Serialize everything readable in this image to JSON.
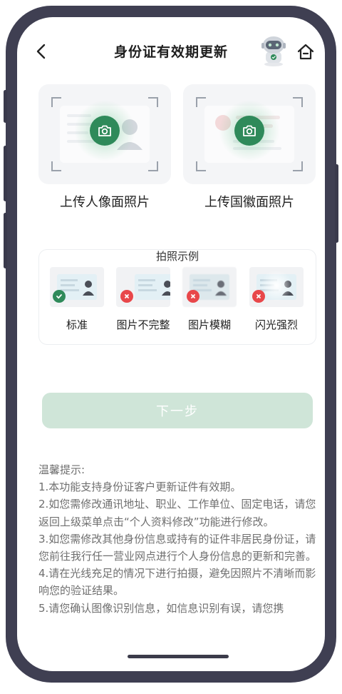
{
  "header": {
    "title": "身份证有效期更新"
  },
  "upload": {
    "front_label": "上传人像面照片",
    "back_label": "上传国徽面照片"
  },
  "examples": {
    "title": "拍照示例",
    "items": [
      {
        "label": "标准",
        "status": "ok"
      },
      {
        "label": "图片不完整",
        "status": "error"
      },
      {
        "label": "图片模糊",
        "status": "error"
      },
      {
        "label": "闪光强烈",
        "status": "error"
      }
    ]
  },
  "next_button": {
    "label": "下一步"
  },
  "tips": {
    "title": "温馨提示:",
    "items": [
      "1.本功能支持身份证客户更新证件有效期。",
      "2.如您需修改通讯地址、职业、工作单位、固定电话，请您返回上级菜单点击“个人资料修改”功能进行修改。",
      "3.如您需修改其他身份信息或持有的证件非居民身份证，请您前往我行任一营业网点进行个人身份信息的更新和完善。",
      "4.请在光线充足的情况下进行拍摄，避免因照片不清晰而影响您的验证结果。",
      "5.请您确认图像识别信息，如信息识别有误，请您携"
    ]
  },
  "colors": {
    "accent": "#2f8a5a",
    "button_disabled": "#cfe5d8",
    "error": "#e8474a",
    "frame": "#3f3f52"
  },
  "icons": {
    "back": "chevron-left-icon",
    "assistant": "robot-icon",
    "home": "home-icon",
    "camera": "camera-icon"
  }
}
